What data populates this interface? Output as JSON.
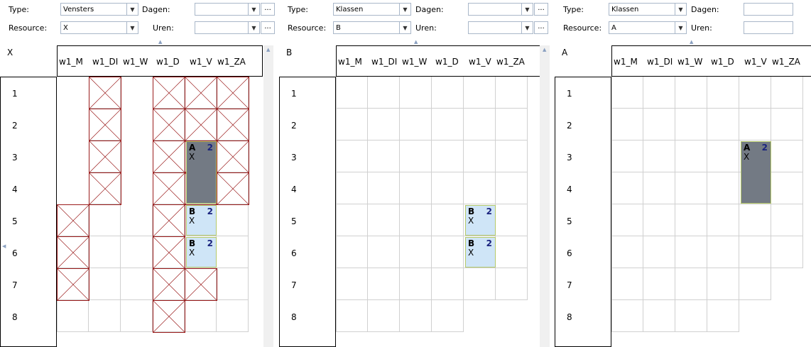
{
  "labels": {
    "type": "Type:",
    "resource": "Resource:",
    "dagen": "Dagen:",
    "uren": "Uren:",
    "ellipsis": "..."
  },
  "days": [
    "w1_M",
    "w1_DI",
    "w1_W",
    "w1_D",
    "w1_V",
    "w1_ZA"
  ],
  "hours": [
    "1",
    "2",
    "3",
    "4",
    "5",
    "6",
    "7",
    "8"
  ],
  "panels": [
    {
      "type": "Vensters",
      "resource": "X",
      "label": "X",
      "availability": [
        [
          0,
          1,
          0,
          1,
          1,
          1
        ],
        [
          0,
          1,
          0,
          1,
          1,
          1
        ],
        [
          0,
          1,
          0,
          1,
          1,
          1
        ],
        [
          0,
          1,
          0,
          1,
          1,
          1
        ],
        [
          1,
          1,
          1,
          1,
          1,
          1
        ],
        [
          1,
          1,
          1,
          1,
          1,
          1
        ],
        [
          1,
          1,
          1,
          1,
          1,
          1
        ],
        [
          1,
          1,
          1,
          1,
          1,
          1
        ]
      ],
      "blocked": [
        [
          0,
          1,
          0,
          1,
          1,
          1
        ],
        [
          0,
          1,
          0,
          1,
          1,
          1
        ],
        [
          0,
          1,
          0,
          1,
          1,
          1
        ],
        [
          0,
          1,
          0,
          1,
          1,
          1
        ],
        [
          1,
          0,
          0,
          1,
          0,
          0
        ],
        [
          1,
          0,
          0,
          1,
          0,
          0
        ],
        [
          1,
          0,
          0,
          1,
          1,
          0
        ],
        [
          0,
          0,
          0,
          1,
          0,
          0
        ]
      ],
      "appointments": [
        {
          "day": 4,
          "hour": 2,
          "span": 2,
          "code": "A",
          "count": "2",
          "sub": "X",
          "style": "dark"
        },
        {
          "day": 4,
          "hour": 4,
          "span": 1,
          "code": "B",
          "count": "2",
          "sub": "X",
          "style": "light"
        },
        {
          "day": 4,
          "hour": 5,
          "span": 1,
          "code": "B",
          "count": "2",
          "sub": "X",
          "style": "light"
        }
      ]
    },
    {
      "type": "Klassen",
      "resource": "B",
      "label": "B",
      "availability": [
        [
          1,
          1,
          1,
          1,
          1,
          1
        ],
        [
          1,
          1,
          1,
          1,
          1,
          1
        ],
        [
          1,
          1,
          1,
          1,
          1,
          1
        ],
        [
          1,
          1,
          1,
          1,
          1,
          1
        ],
        [
          1,
          1,
          1,
          1,
          1,
          1
        ],
        [
          1,
          1,
          1,
          1,
          1,
          1
        ],
        [
          1,
          1,
          1,
          1,
          1,
          1
        ],
        [
          1,
          1,
          1,
          1,
          0,
          0
        ]
      ],
      "blocked": [],
      "appointments": [
        {
          "day": 4,
          "hour": 4,
          "span": 1,
          "code": "B",
          "count": "2",
          "sub": "X",
          "style": "light"
        },
        {
          "day": 4,
          "hour": 5,
          "span": 1,
          "code": "B",
          "count": "2",
          "sub": "X",
          "style": "light"
        }
      ]
    },
    {
      "type": "Klassen",
      "resource": "A",
      "label": "A",
      "availability": [
        [
          1,
          1,
          1,
          1,
          1,
          1
        ],
        [
          1,
          1,
          1,
          1,
          1,
          1
        ],
        [
          1,
          1,
          1,
          1,
          1,
          1
        ],
        [
          1,
          1,
          1,
          1,
          1,
          1
        ],
        [
          1,
          1,
          1,
          1,
          1,
          1
        ],
        [
          1,
          1,
          1,
          1,
          1,
          1
        ],
        [
          1,
          1,
          1,
          1,
          1,
          0
        ],
        [
          1,
          1,
          1,
          1,
          0,
          0
        ]
      ],
      "blocked": [],
      "appointments": [
        {
          "day": 4,
          "hour": 2,
          "span": 2,
          "code": "A",
          "count": "2",
          "sub": "X",
          "style": "dark"
        }
      ]
    }
  ],
  "colors": {
    "dark": "#737a84",
    "light": "#cfe5f7",
    "blocked": "#9b1c1c"
  }
}
